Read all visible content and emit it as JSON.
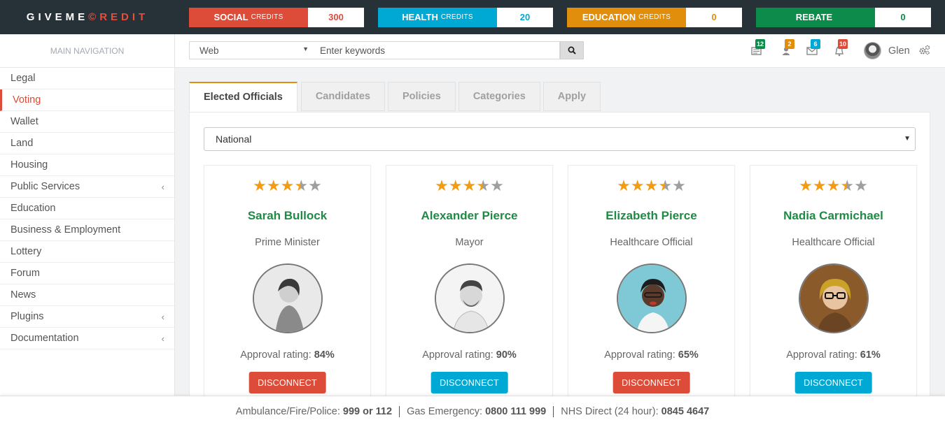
{
  "brand": {
    "part1": "GIVEME",
    "mark": "©",
    "part2": "REDIT"
  },
  "credits": [
    {
      "label": "SOCIAL",
      "suffix": "CREDITS",
      "value": "300",
      "color": "#dd4b39",
      "value_color": "#dd4b39"
    },
    {
      "label": "HEALTH",
      "suffix": "CREDITS",
      "value": "20",
      "color": "#00a9d4",
      "value_color": "#00a9d4"
    },
    {
      "label": "EDUCATION",
      "suffix": "CREDITS",
      "value": "0",
      "color": "#e08e0b",
      "value_color": "#e08e0b"
    },
    {
      "label": "REBATE",
      "suffix": "",
      "value": "0",
      "color": "#0d8b4a",
      "value_color": "#0d8b4a"
    }
  ],
  "sidebar": {
    "header": "MAIN NAVIGATION",
    "items": [
      {
        "label": "Legal",
        "chevron": false,
        "active": false
      },
      {
        "label": "Voting",
        "chevron": false,
        "active": true
      },
      {
        "label": "Wallet",
        "chevron": false,
        "active": false
      },
      {
        "label": "Land",
        "chevron": false,
        "active": false
      },
      {
        "label": "Housing",
        "chevron": false,
        "active": false
      },
      {
        "label": "Public Services",
        "chevron": true,
        "active": false
      },
      {
        "label": "Education",
        "chevron": false,
        "active": false
      },
      {
        "label": "Business & Employment",
        "chevron": false,
        "active": false
      },
      {
        "label": "Lottery",
        "chevron": false,
        "active": false
      },
      {
        "label": "Forum",
        "chevron": false,
        "active": false
      },
      {
        "label": "News",
        "chevron": false,
        "active": false
      },
      {
        "label": "Plugins",
        "chevron": true,
        "active": false
      },
      {
        "label": "Documentation",
        "chevron": true,
        "active": false
      }
    ]
  },
  "search": {
    "scope": "Web",
    "placeholder": "Enter keywords"
  },
  "header_icons": [
    {
      "name": "newspaper-icon",
      "badge": "12",
      "badge_color": "#0d8b4a"
    },
    {
      "name": "user-icon",
      "badge": "2",
      "badge_color": "#e08e0b"
    },
    {
      "name": "envelope-icon",
      "badge": "6",
      "badge_color": "#00a9d4"
    },
    {
      "name": "bell-icon",
      "badge": "10",
      "badge_color": "#dd4b39"
    }
  ],
  "user": {
    "name": "Glen"
  },
  "tabs": [
    {
      "label": "Elected Officials",
      "active": true
    },
    {
      "label": "Candidates",
      "active": false
    },
    {
      "label": "Policies",
      "active": false
    },
    {
      "label": "Categories",
      "active": false
    },
    {
      "label": "Apply",
      "active": false
    }
  ],
  "region_select": "National",
  "officials": [
    {
      "name": "Sarah Bullock",
      "role": "Prime Minister",
      "rating_stars": 3.5,
      "approval_label": "Approval rating:",
      "approval": "84%",
      "button": "DISCONNECT",
      "button_color": "red"
    },
    {
      "name": "Alexander Pierce",
      "role": "Mayor",
      "rating_stars": 3.5,
      "approval_label": "Approval rating:",
      "approval": "90%",
      "button": "DISCONNECT",
      "button_color": "blue"
    },
    {
      "name": "Elizabeth Pierce",
      "role": "Healthcare Official",
      "rating_stars": 3.5,
      "approval_label": "Approval rating:",
      "approval": "65%",
      "button": "DISCONNECT",
      "button_color": "red"
    },
    {
      "name": "Nadia Carmichael",
      "role": "Healthcare Official",
      "rating_stars": 3.5,
      "approval_label": "Approval rating:",
      "approval": "61%",
      "button": "DISCONNECT",
      "button_color": "blue"
    }
  ],
  "footer": [
    {
      "label": "Ambulance/Fire/Police:",
      "value": "999 or 112"
    },
    {
      "label": "Gas Emergency:",
      "value": "0800 111 999"
    },
    {
      "label": "NHS Direct (24 hour):",
      "value": "0845 4647"
    }
  ]
}
